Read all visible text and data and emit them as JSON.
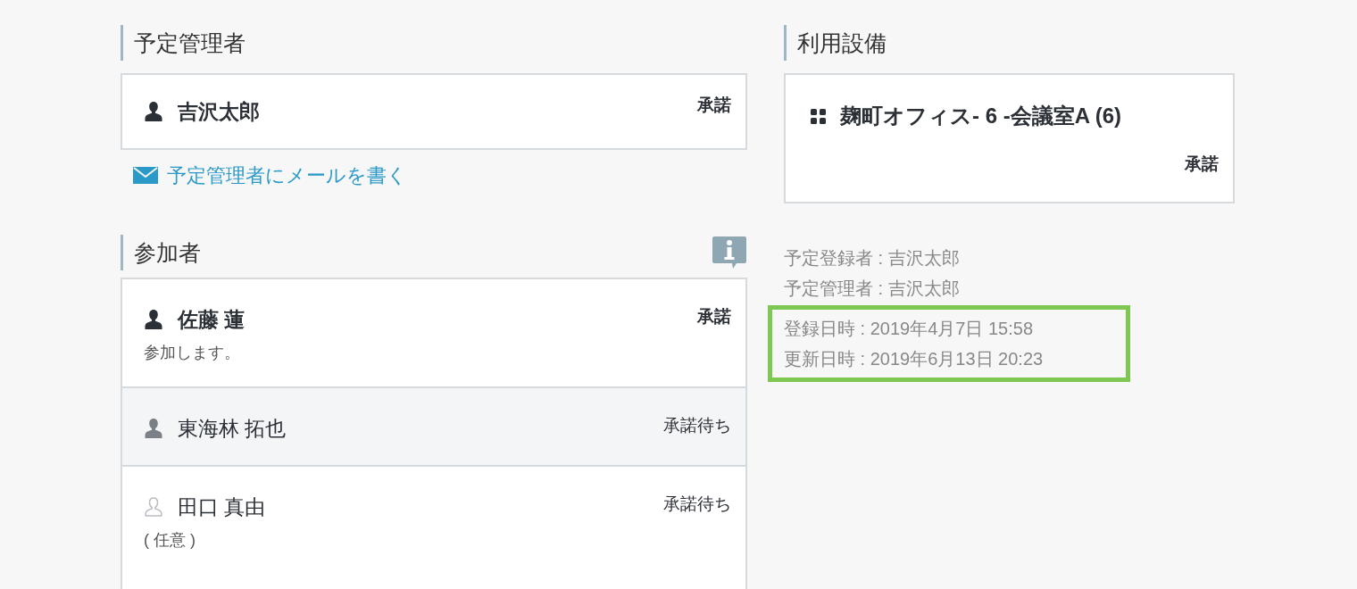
{
  "organizer": {
    "heading": "予定管理者",
    "person": {
      "name": "吉沢太郎",
      "status": "承諾",
      "accepted": true
    },
    "mail_link": "予定管理者にメールを書く"
  },
  "participants": {
    "heading": "参加者",
    "rows": [
      {
        "name": "佐藤 蓮",
        "status": "承諾",
        "accepted": true,
        "optional": false,
        "selected": false,
        "note": "参加します。"
      },
      {
        "name": "東海林 拓也",
        "status": "承諾待ち",
        "accepted": false,
        "optional": false,
        "selected": true
      },
      {
        "name": "田口 真由",
        "status": "承諾待ち",
        "accepted": false,
        "optional": true,
        "selected": false,
        "note": "( 任意 )"
      }
    ]
  },
  "facility": {
    "heading": "利用設備",
    "name": "麹町オフィス- 6 -会議室A (6)",
    "status": "承諾",
    "accepted": true
  },
  "meta": [
    "予定登録者 : 吉沢太郎",
    "予定管理者 : 吉沢太郎"
  ],
  "highlighted_meta": [
    "登録日時 : 2019年4月7日 15:58",
    "更新日時 : 2019年6月13日 20:23"
  ]
}
